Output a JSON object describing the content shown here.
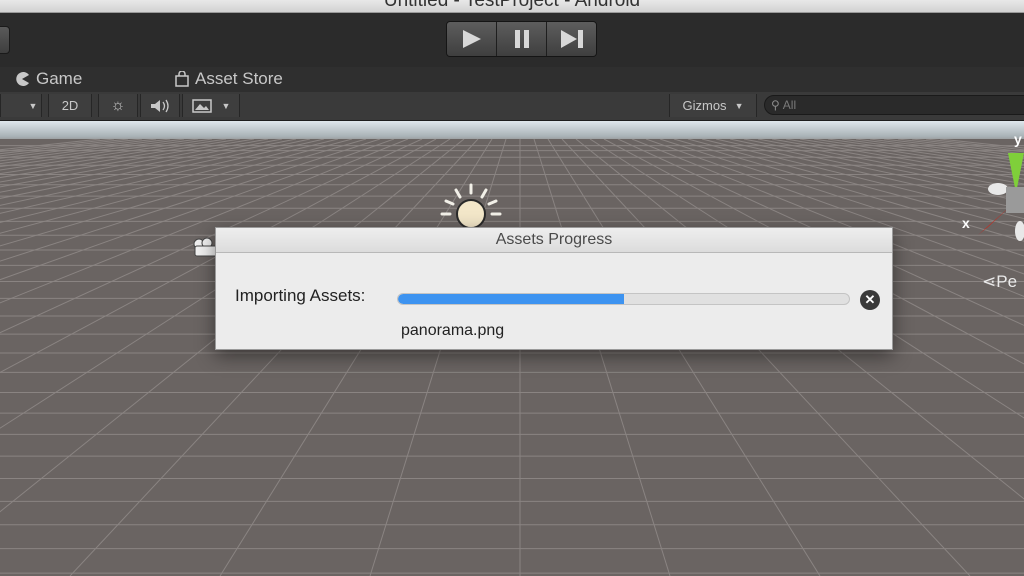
{
  "window": {
    "title": "Untitled - TestProject - Android"
  },
  "toolbar": {
    "play_icon": "play-icon",
    "pause_icon": "pause-icon",
    "step_icon": "step-icon"
  },
  "tabs": [
    {
      "label": "Game",
      "icon": "pacman-icon"
    },
    {
      "label": "Asset Store",
      "icon": "store-icon"
    }
  ],
  "scene_toolbar": {
    "mode_2d": "2D",
    "gizmos": "Gizmos",
    "search_placeholder": "All"
  },
  "viewport": {
    "axis_y": "y",
    "axis_x": "x",
    "persp_label": "Pe"
  },
  "dialog": {
    "title": "Assets Progress",
    "label": "Importing Assets:",
    "progress": 0.5,
    "filename": "panorama.png"
  },
  "colors": {
    "progress": "#3d93f0",
    "toolbar_bg": "#2b2b2b",
    "ground": "#6a6462"
  }
}
